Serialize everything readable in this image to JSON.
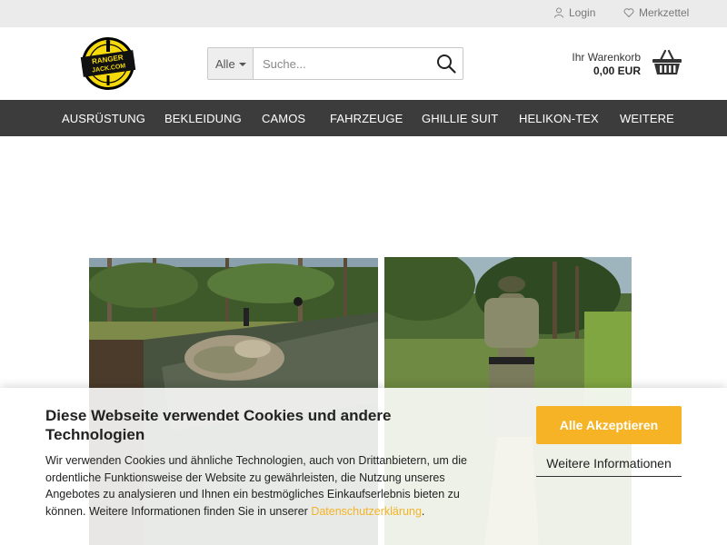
{
  "topbar": {
    "login_label": "Login",
    "wishlist_label": "Merkzettel"
  },
  "logo": {
    "line1": "RANGER",
    "line2": "JACK.COM"
  },
  "search": {
    "category_label": "Alle",
    "placeholder": "Suche..."
  },
  "cart": {
    "label": "Ihr Warenkorb",
    "total": "0,00 EUR"
  },
  "nav": {
    "items": [
      "AUSRÜSTUNG",
      "BEKLEIDUNG",
      "CAMOS",
      "FAHRZEUGE",
      "GHILLIE SUIT",
      "HELIKON-TEX",
      "WEITERE"
    ]
  },
  "cookie": {
    "title": "Diese Webseite verwendet Cookies und andere Technologien",
    "body": "Wir verwenden Cookies und ähnliche Technologien, auch von Drittanbietern, um die ordentliche Funktionsweise der Website zu gewährleisten, die Nutzung unseres Angebotes zu analysieren und Ihnen ein bestmögliches Einkaufserlebnis bieten zu können. Weitere Informationen finden Sie in unserer ",
    "privacy_link": "Datenschutzerklärung",
    "body_end": ".",
    "accept_label": "Alle Akzeptieren",
    "more_label": "Weitere Informationen"
  },
  "colors": {
    "accent": "#f5b325",
    "nav_bg": "#3c3c3c",
    "topbar_bg": "#ebebeb"
  }
}
